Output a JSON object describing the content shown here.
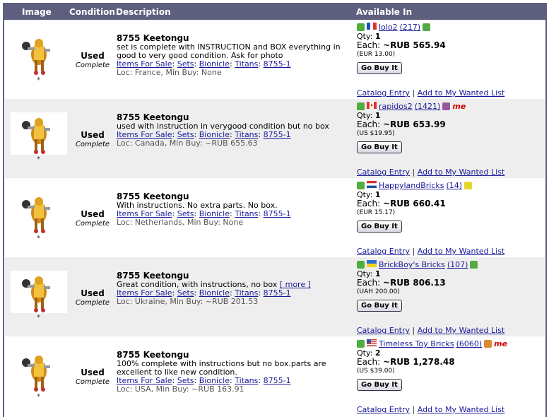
{
  "columns": {
    "image": "Image",
    "condition": "Condition",
    "description": "Description",
    "available": "Available In"
  },
  "common": {
    "thumb_star": "*",
    "qty_label": "Qty:",
    "each_label": "Each:",
    "go_buy": "Go Buy It",
    "catalog_entry": "Catalog Entry",
    "separator": "|",
    "wanted_list": "Add to My Wanted List",
    "cat_items": "Items For Sale",
    "cat_sets": "Sets",
    "cat_bionicle": "Bionicle",
    "cat_titans": "Titans",
    "cat_itemno": "8755-1",
    "colon": ":"
  },
  "listings": [
    {
      "condition": "Used",
      "completeness": "Complete",
      "title": "8755 Keetongu",
      "description": "set is complete with INSTRUCTION and BOX everything in good to very good condition. Ask for photo",
      "more": "",
      "loc": "Loc: France, Min Buy: None",
      "seller": "lolo2",
      "feedback": "(217)",
      "flag": "france",
      "qty": "1",
      "each": "~RUB 565.94",
      "orig_price": "(EUR 13.00)",
      "badge_color": "#55aa44",
      "me": ""
    },
    {
      "condition": "Used",
      "completeness": "Complete",
      "title": "8755 Keetongu",
      "description": "used with instruction in verygood condition but no box",
      "more": "",
      "loc": "Loc: Canada, Min Buy: ~RUB 655.63",
      "seller": "rapidos2",
      "feedback": "(1421)",
      "flag": "canada",
      "qty": "1",
      "each": "~RUB 653.99",
      "orig_price": "(US $19.95)",
      "badge_color": "#995599",
      "me": "me"
    },
    {
      "condition": "Used",
      "completeness": "Complete",
      "title": "8755 Keetongu",
      "description": "With instructions. No extra parts. No box.",
      "more": "",
      "loc": "Loc: Netherlands, Min Buy: None",
      "seller": "HappylandBricks",
      "feedback": "(14)",
      "flag": "netherlands",
      "qty": "1",
      "each": "~RUB 660.41",
      "orig_price": "(EUR 15.17)",
      "badge_color": "#e6d82a",
      "me": ""
    },
    {
      "condition": "Used",
      "completeness": "Complete",
      "title": "8755 Keetongu",
      "description": " Great condition, with instructions, no box",
      "more": "[ more ]",
      "loc": "Loc: Ukraine, Min Buy: ~RUB 201.53",
      "seller": "BrickBoy's Bricks",
      "feedback": "(107)",
      "flag": "ukraine",
      "qty": "1",
      "each": "~RUB 806.13",
      "orig_price": "(UAH 200.00)",
      "badge_color": "#55aa44",
      "me": ""
    },
    {
      "condition": "Used",
      "completeness": "Complete",
      "title": "8755 Keetongu",
      "description": "100% complete with instructions but no box.parts are excellent to like new condition.",
      "more": "",
      "loc": "Loc: USA, Min Buy: ~RUB 163.91",
      "seller": "Timeless Toy Bricks",
      "feedback": "(6060)",
      "flag": "usa",
      "qty": "2",
      "each": "~RUB 1,278.48",
      "orig_price": "(US $39.00)",
      "badge_color": "#dd8833",
      "me": "me"
    }
  ]
}
